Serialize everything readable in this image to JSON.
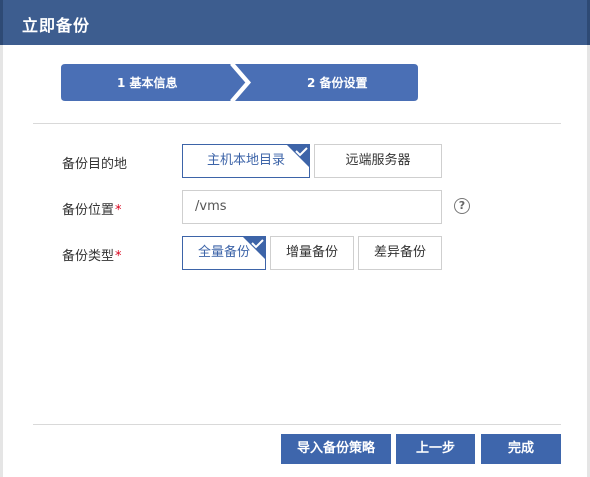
{
  "dialog": {
    "title": "立即备份"
  },
  "steps": [
    {
      "label": "1 基本信息"
    },
    {
      "label": "2 备份设置"
    }
  ],
  "form": {
    "target": {
      "label": "备份目的地",
      "options": [
        {
          "label": "主机本地目录",
          "selected": true
        },
        {
          "label": "远端服务器",
          "selected": false
        }
      ]
    },
    "location": {
      "label": "备份位置",
      "required_mark": "*",
      "value": "/vms",
      "help_icon": "question-circle-icon",
      "help_glyph": "?"
    },
    "type": {
      "label": "备份类型",
      "required_mark": "*",
      "options": [
        {
          "label": "全量备份",
          "selected": true
        },
        {
          "label": "增量备份",
          "selected": false
        },
        {
          "label": "差异备份",
          "selected": false
        }
      ]
    }
  },
  "footer": {
    "import_label": "导入备份策略",
    "prev_label": "上一步",
    "finish_label": "完成"
  },
  "colors": {
    "header": "#3d5d8f",
    "accent": "#3e66ac",
    "required": "#d9001b"
  }
}
